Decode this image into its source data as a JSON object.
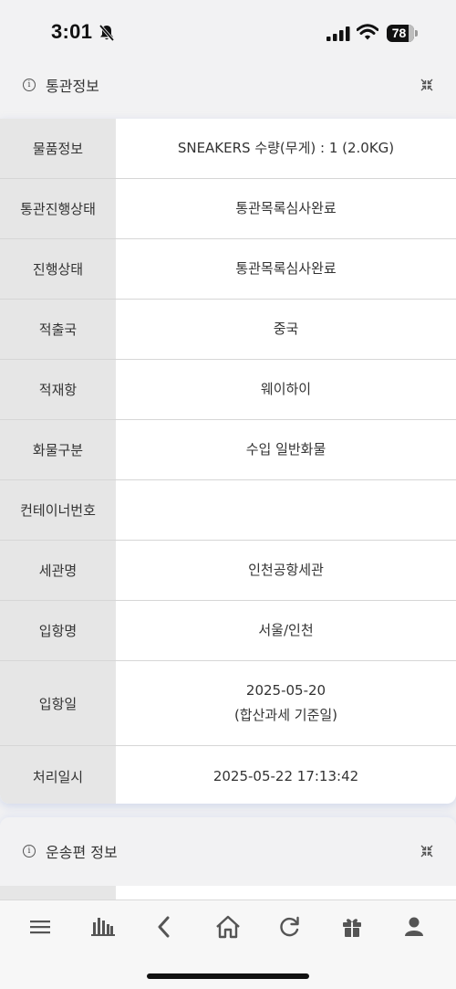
{
  "status_bar": {
    "time": "3:01",
    "battery": "78",
    "icons": [
      "bell-off-icon",
      "signal-icon",
      "wifi-icon",
      "battery-icon"
    ]
  },
  "customs_section": {
    "title": "통관정보",
    "info_icon_glyph": "i",
    "rows": [
      {
        "label": "물품정보",
        "value": "SNEAKERS 수량(무게) : 1 (2.0KG)"
      },
      {
        "label": "통관진행상태",
        "value": "통관목록심사완료"
      },
      {
        "label": "진행상태",
        "value": "통관목록심사완료"
      },
      {
        "label": "적출국",
        "value": "중국"
      },
      {
        "label": "적재항",
        "value": "웨이하이"
      },
      {
        "label": "화물구분",
        "value": "수입 일반화물"
      },
      {
        "label": "컨테이너번호",
        "value": ""
      },
      {
        "label": "세관명",
        "value": "인천공항세관"
      },
      {
        "label": "입항명",
        "value": "서울/인천"
      },
      {
        "label": "입항일",
        "value": "2025-05-20",
        "value_line2": "(합산과세 기준일)"
      },
      {
        "label": "처리일시",
        "value": "2025-05-22 17:13:42"
      }
    ]
  },
  "shipping_section": {
    "title": "운송편 정보",
    "info_icon_glyph": "i"
  },
  "bottom_nav": {
    "items": [
      "menu-icon",
      "chart-icon",
      "back-icon",
      "home-icon",
      "refresh-icon",
      "gift-icon",
      "profile-icon"
    ]
  },
  "colors": {
    "background": "#f2f2f3",
    "label_bg": "#e6e6e6",
    "value_bg": "#ffffff",
    "divider": "#d6d6d6",
    "icon": "#555555"
  }
}
